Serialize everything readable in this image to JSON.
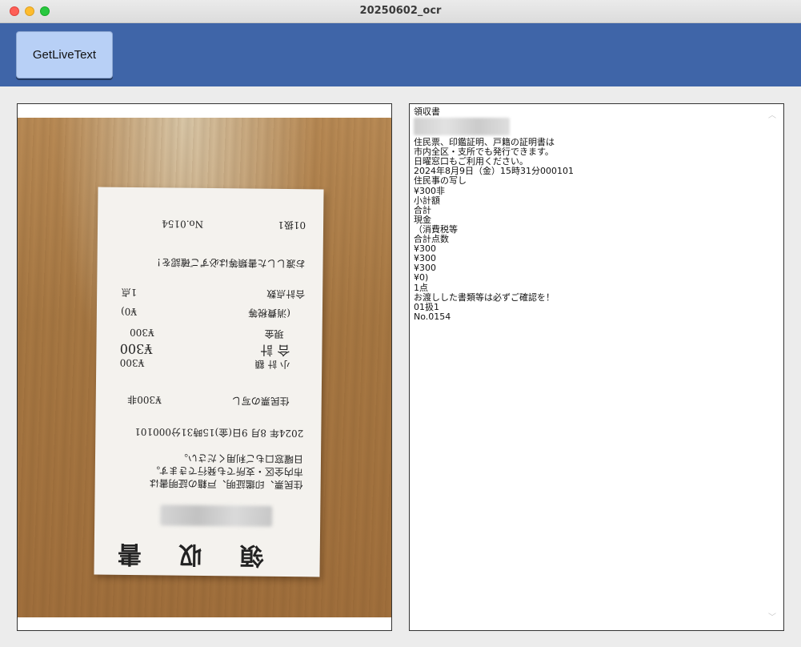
{
  "window": {
    "title": "20250602_ocr"
  },
  "toolbar": {
    "live_text_label": "GetLiveText"
  },
  "receipt": {
    "heading": "領 収 書",
    "lines": [
      "住民票、印鑑証明、戸籍の証明書は",
      "市内全区・支所でも発行できます。",
      "日曜窓口もご利用ください。",
      "2024年 8月 9日(金)15時31分000101",
      "住民票の写し",
      "¥300非",
      "小 計 額",
      "¥300",
      "合 計",
      "¥300",
      "現金",
      "¥300",
      "(消費税等",
      "¥0)",
      "合計点数",
      "1点",
      "お渡しした書類等は必ずご確認を！",
      "01扱1",
      "No.0154"
    ]
  },
  "ocr": {
    "lines": [
      "領収書",
      "住民票、印鑑証明、戸籍の証明書は",
      "市内全区・支所でも発行できます。",
      "日曜窓口もご利用ください。",
      "2024年8月9日（金）15時31分000101",
      "住民事の写し",
      "¥300非",
      "小計額",
      "合計",
      "現金",
      "（消費税等",
      "合計点数",
      "¥300",
      "¥300",
      "¥300",
      "¥0)",
      "1点",
      "お渡しした書類等は必ずご確認を！",
      "01扱1",
      "No.0154"
    ]
  },
  "icons": {
    "close": "close-icon",
    "minimize": "minimize-icon",
    "maximize": "maximize-icon",
    "scroll_up": "chevron-up-icon",
    "scroll_down": "chevron-down-icon"
  },
  "colors": {
    "toolbar": "#3f65a8",
    "button": "#b8d0f6",
    "close": "#fe5f57",
    "minimize": "#febc2e",
    "maximize": "#28c840"
  }
}
